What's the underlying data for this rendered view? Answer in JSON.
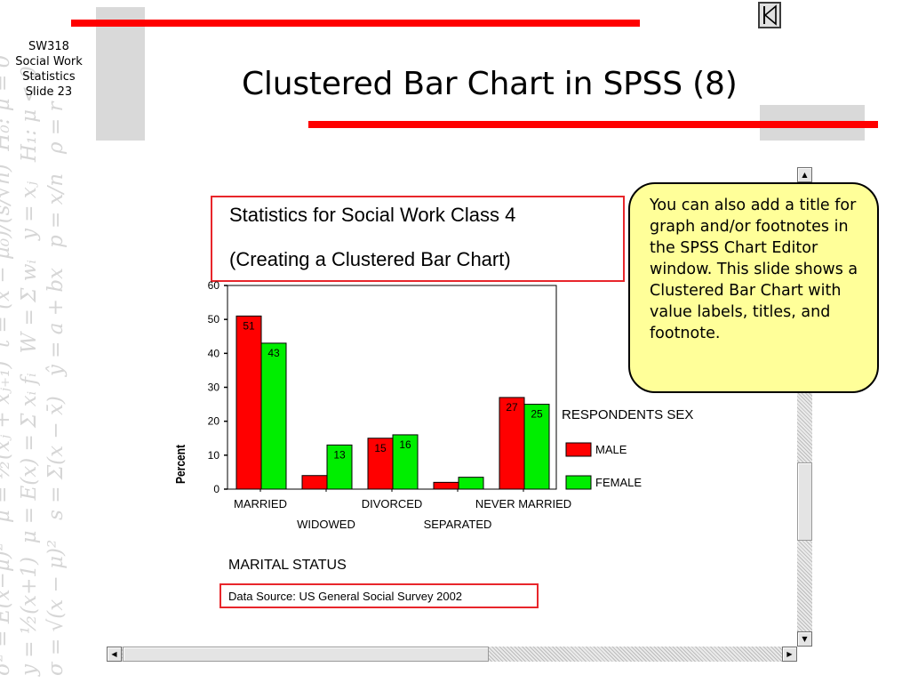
{
  "slide": {
    "course_lines": [
      "SW318",
      "Social Work",
      "Statistics",
      "Slide 23"
    ],
    "title": "Clustered Bar Chart in SPSS (8)",
    "callout": "You can also add a title for graph and/or footnotes in the SPSS Chart Editor window. This slide shows a Clustered Bar Chart with value labels, titles, and footnote."
  },
  "colors": {
    "accent_red": "#ff0000",
    "male": "#ff0000",
    "female": "#00ee00",
    "callout_bg": "#ffff99",
    "header_gray": "#d9d9d9"
  },
  "icons": {
    "nav": "first-slide-icon",
    "bullet": "arrow-bullet-icon",
    "scroll_up": "scroll-up-arrow-icon",
    "scroll_down": "scroll-down-arrow-icon",
    "scroll_left": "scroll-left-arrow-icon",
    "scroll_right": "scroll-right-arrow-icon"
  },
  "bullet_char": "➜",
  "chart_data": {
    "type": "bar",
    "title": "Statistics for Social Work Class 4",
    "subtitle": "(Creating a Clustered Bar Chart)",
    "xlabel": "MARITAL STATUS",
    "ylabel": "Percent",
    "footnote": "Data Source: US General Social Survey 2002",
    "legend_title": "RESPONDENTS SEX",
    "legend_position": "right",
    "ylim": [
      0,
      60
    ],
    "yticks": [
      0,
      10,
      20,
      30,
      40,
      50,
      60
    ],
    "categories": [
      "MARRIED",
      "WIDOWED",
      "DIVORCED",
      "SEPARATED",
      "NEVER MARRIED"
    ],
    "series": [
      {
        "name": "MALE",
        "color": "#ff0000",
        "values": [
          51,
          4,
          15,
          2,
          27
        ],
        "labels": [
          "51",
          "",
          "15",
          "",
          "27"
        ]
      },
      {
        "name": "FEMALE",
        "color": "#00ee00",
        "values": [
          43,
          13,
          16,
          3.5,
          25
        ],
        "labels": [
          "43",
          "13",
          "16",
          "",
          "25"
        ]
      }
    ],
    "grid": false
  }
}
